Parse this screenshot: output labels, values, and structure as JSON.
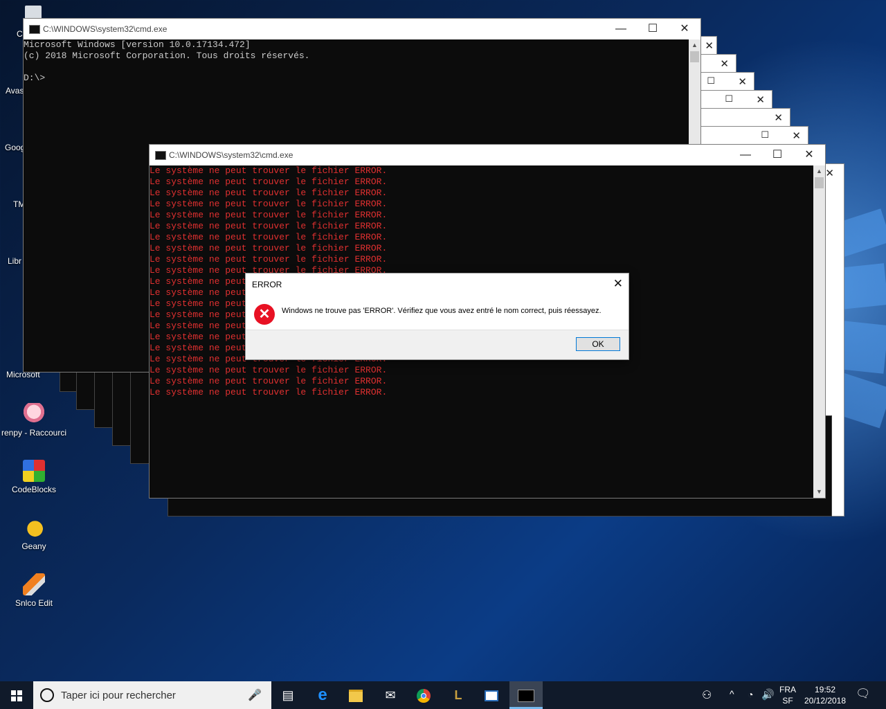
{
  "desktop": {
    "peek_labels": [
      "C",
      "Avas",
      "Goog",
      "TM",
      "Libr",
      "Microsoft"
    ],
    "icons": [
      {
        "label": "renpy - Raccourci",
        "icon": "renpy-icon"
      },
      {
        "label": "CodeBlocks",
        "icon": "codeblocks-icon"
      },
      {
        "label": "Geany",
        "icon": "geany-icon"
      },
      {
        "label": "Snlco Edit",
        "icon": "snlco-edit-icon"
      }
    ]
  },
  "window1": {
    "title": "C:\\WINDOWS\\system32\\cmd.exe",
    "output": "Microsoft Windows [version 10.0.17134.472]\n(c) 2018 Microsoft Corporation. Tous droits réservés.\n\nD:\\>"
  },
  "window2": {
    "title": "C:\\WINDOWS\\system32\\cmd.exe",
    "error_line": "Le système ne peut trouver le fichier ERROR.",
    "error_color": "#e03030"
  },
  "dialog": {
    "title": "ERROR",
    "message": "Windows ne trouve pas 'ERROR'. Vérifiez que vous avez entré le nom correct, puis réessayez.",
    "ok_label": "OK"
  },
  "taskbar": {
    "search_placeholder": "Taper ici pour rechercher",
    "language": "FRA",
    "keyboard": "SF",
    "time": "19:52",
    "date": "20/12/2018"
  }
}
